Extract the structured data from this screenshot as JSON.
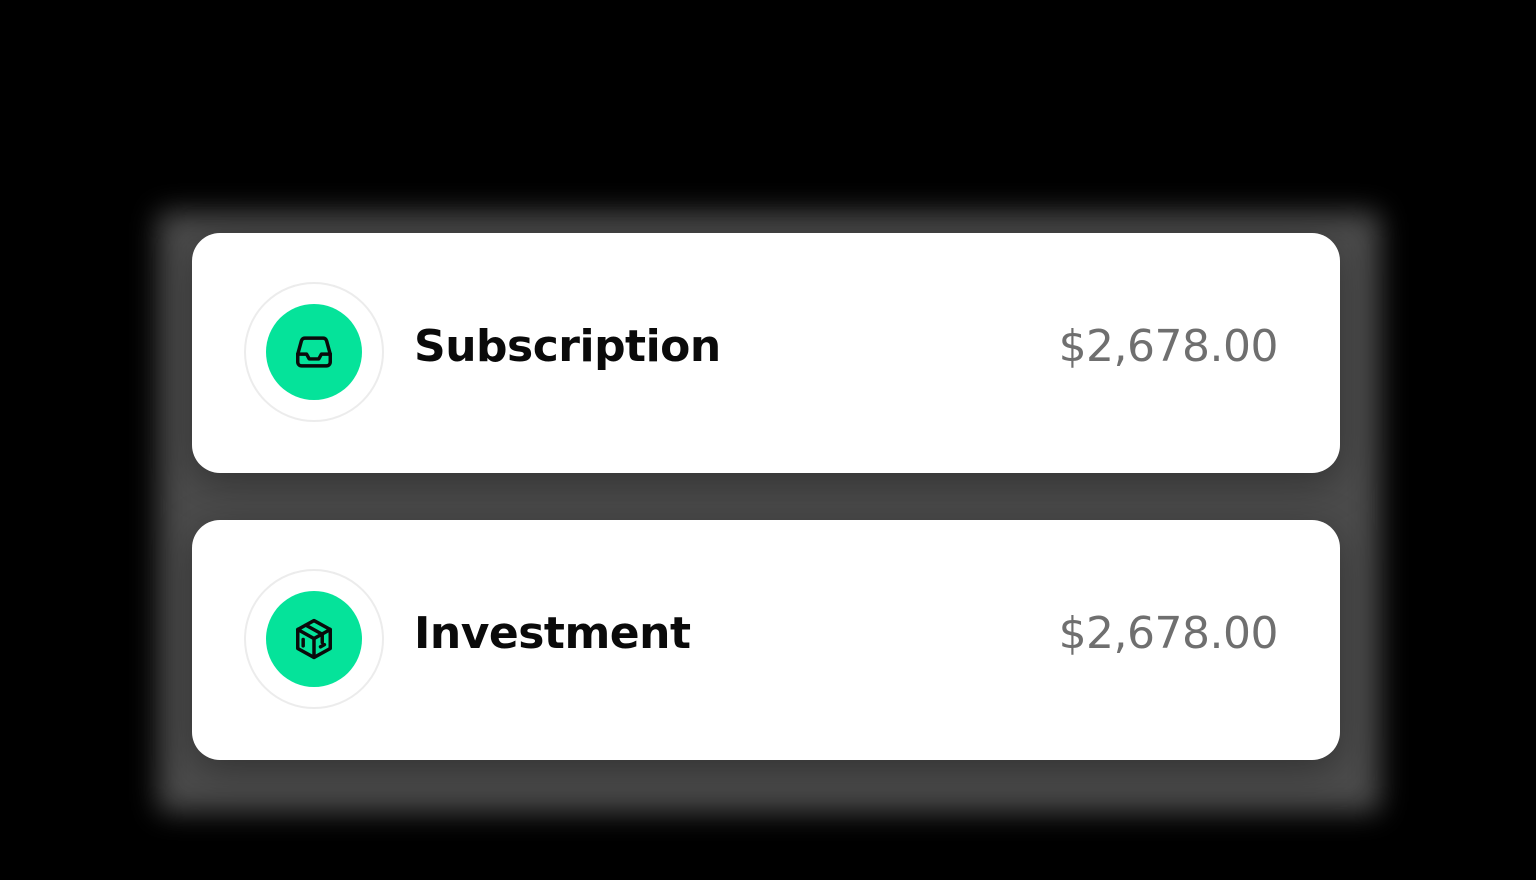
{
  "transactions": [
    {
      "label": "Subscription",
      "amount": "$2,678.00",
      "icon": "inbox-tray-icon"
    },
    {
      "label": "Investment",
      "amount": "$2,678.00",
      "icon": "cube-box-icon"
    }
  ],
  "colors": {
    "accent": "#05e39a",
    "label_text": "#0a0a0a",
    "amount_text": "#6f6f6f",
    "card_bg": "#ffffff",
    "page_bg": "#000000"
  }
}
